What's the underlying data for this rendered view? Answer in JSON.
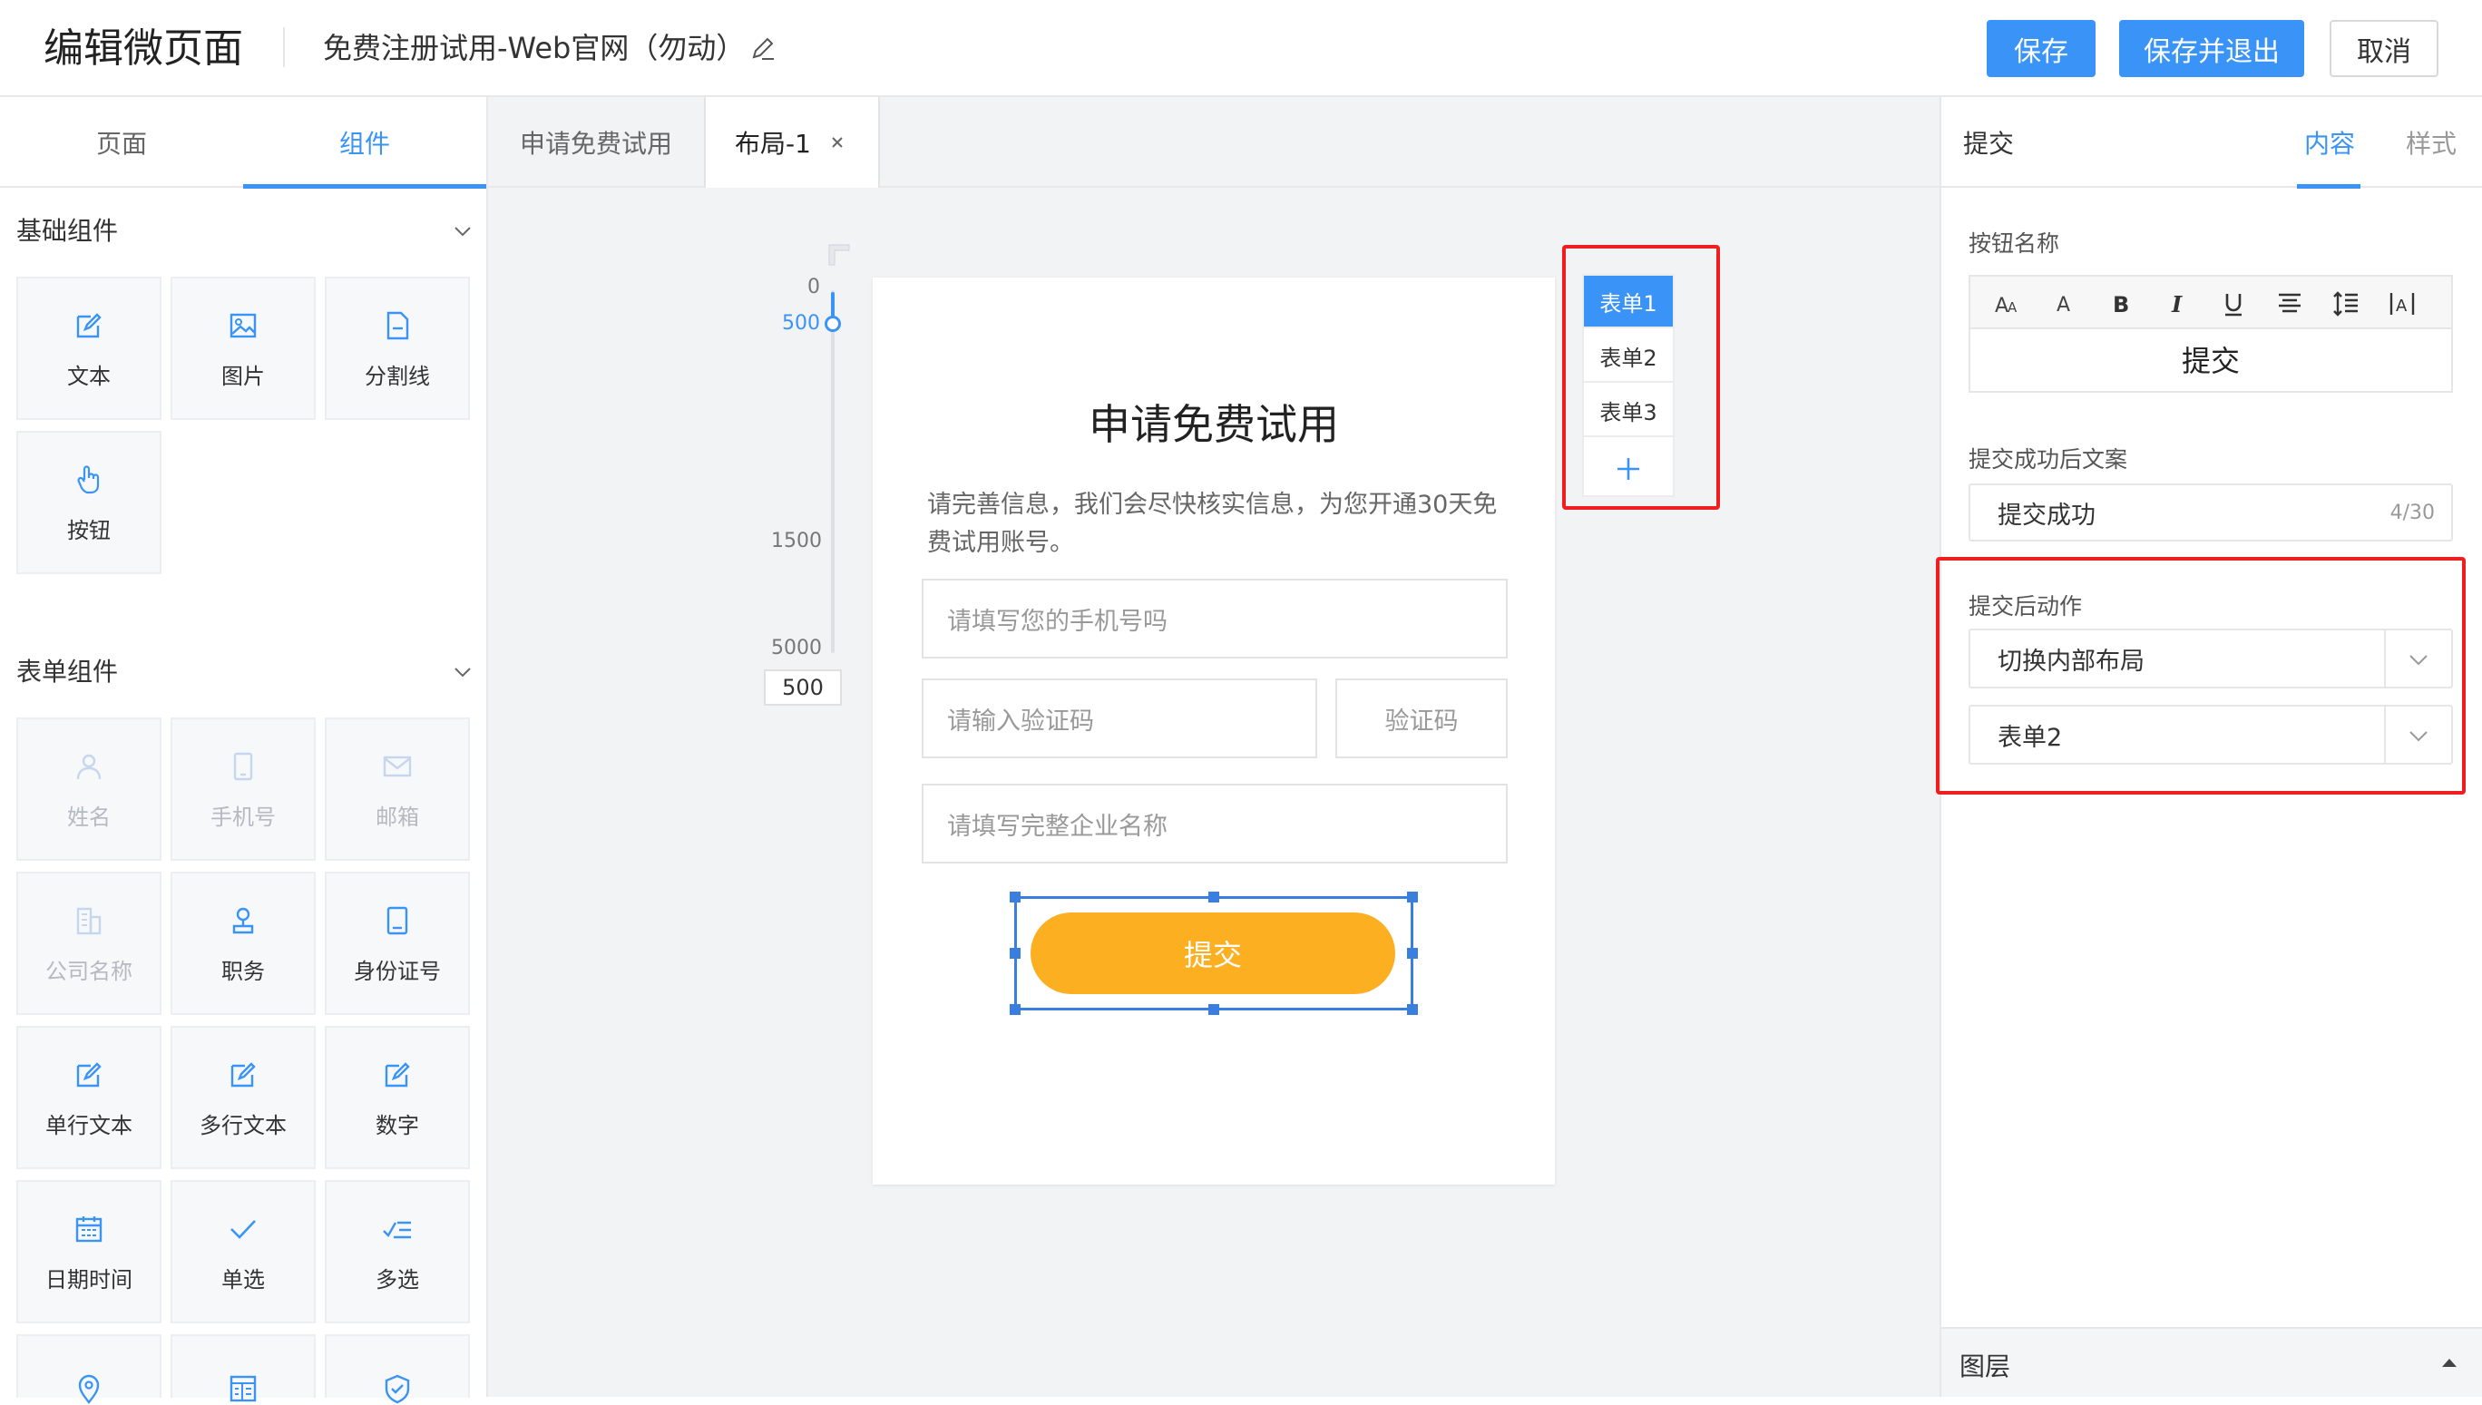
{
  "header": {
    "title": "编辑微页面",
    "page_name": "免费注册试用-Web官网（勿动）",
    "save_label": "保存",
    "save_exit_label": "保存并退出",
    "cancel_label": "取消"
  },
  "left_panel": {
    "tabs": [
      "页面",
      "组件"
    ],
    "active_tab": "组件",
    "basic_section": "基础组件",
    "basic_items": [
      {
        "label": "文本",
        "icon": "edit-icon"
      },
      {
        "label": "图片",
        "icon": "image-icon"
      },
      {
        "label": "分割线",
        "icon": "document-icon"
      },
      {
        "label": "按钮",
        "icon": "pointer-hand-icon"
      }
    ],
    "form_section": "表单组件",
    "form_items": [
      {
        "label": "姓名",
        "icon": "person-icon",
        "disabled": true
      },
      {
        "label": "手机号",
        "icon": "mobile-icon",
        "disabled": true
      },
      {
        "label": "邮箱",
        "icon": "mail-icon",
        "disabled": true
      },
      {
        "label": "公司名称",
        "icon": "building-icon",
        "disabled": true
      },
      {
        "label": "职务",
        "icon": "position-icon",
        "disabled": false
      },
      {
        "label": "身份证号",
        "icon": "id-card-icon",
        "disabled": false
      },
      {
        "label": "单行文本",
        "icon": "edit-icon",
        "disabled": false
      },
      {
        "label": "多行文本",
        "icon": "edit-icon",
        "disabled": false
      },
      {
        "label": "数字",
        "icon": "edit-icon",
        "disabled": false
      },
      {
        "label": "日期时间",
        "icon": "calendar-icon",
        "disabled": false
      },
      {
        "label": "单选",
        "icon": "check-icon",
        "disabled": false
      },
      {
        "label": "多选",
        "icon": "checklist-icon",
        "disabled": false
      }
    ]
  },
  "canvas": {
    "tabs": [
      "申请免费试用",
      "布局-1"
    ],
    "active_tab": "布局-1",
    "ruler": {
      "top": "0",
      "current": "500",
      "mid": "1500",
      "max": "5000",
      "input_value": "500"
    },
    "page": {
      "title": "申请免费试用",
      "description": "请完善信息，我们会尽快核实信息，为您开通30天免费试用账号。",
      "phone_placeholder": "请填写您的手机号吗",
      "code_placeholder": "请输入验证码",
      "code_button": "验证码",
      "company_placeholder": "请填写完整企业名称",
      "submit_label": "提交"
    },
    "form_switcher": {
      "items": [
        "表单1",
        "表单2",
        "表单3"
      ],
      "active": "表单1"
    }
  },
  "right_panel": {
    "title": "提交",
    "tabs": [
      "内容",
      "样式"
    ],
    "active_tab": "内容",
    "button_name_label": "按钮名称",
    "button_name_value": "提交",
    "success_text_label": "提交成功后文案",
    "success_text_value": "提交成功",
    "success_text_count": "4/30",
    "action_label": "提交后动作",
    "action_value": "切换内部布局",
    "target_value": "表单2",
    "layers_label": "图层"
  },
  "colors": {
    "primary": "#3a93f6",
    "submit": "#fdaf22",
    "highlight": "#f01e1e"
  }
}
